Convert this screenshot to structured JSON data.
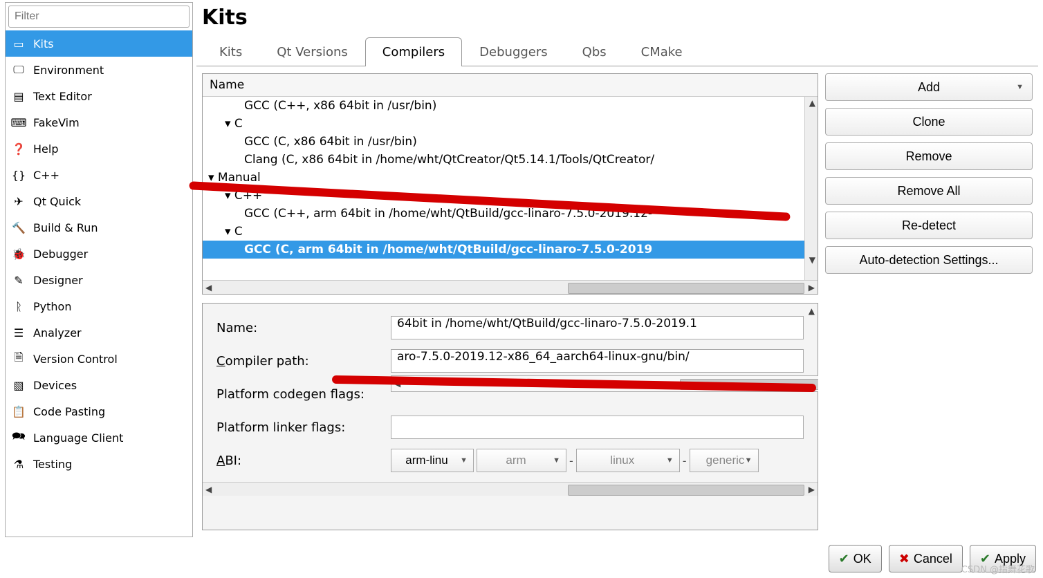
{
  "filter_placeholder": "Filter",
  "sidebar": {
    "items": [
      {
        "label": "Kits",
        "icon": "kits"
      },
      {
        "label": "Environment",
        "icon": "monitor"
      },
      {
        "label": "Text Editor",
        "icon": "document"
      },
      {
        "label": "FakeVim",
        "icon": "fakevim"
      },
      {
        "label": "Help",
        "icon": "help"
      },
      {
        "label": "C++",
        "icon": "braces"
      },
      {
        "label": "Qt Quick",
        "icon": "send"
      },
      {
        "label": "Build & Run",
        "icon": "hammer"
      },
      {
        "label": "Debugger",
        "icon": "bug"
      },
      {
        "label": "Designer",
        "icon": "pencil"
      },
      {
        "label": "Python",
        "icon": "python"
      },
      {
        "label": "Analyzer",
        "icon": "analyzer"
      },
      {
        "label": "Version Control",
        "icon": "versioncontrol"
      },
      {
        "label": "Devices",
        "icon": "devices"
      },
      {
        "label": "Code Pasting",
        "icon": "clipboard"
      },
      {
        "label": "Language Client",
        "icon": "language"
      },
      {
        "label": "Testing",
        "icon": "flask"
      }
    ],
    "selected_index": 0
  },
  "page_title": "Kits",
  "tabs": [
    "Kits",
    "Qt Versions",
    "Compilers",
    "Debuggers",
    "Qbs",
    "CMake"
  ],
  "active_tab": 2,
  "tree": {
    "header": "Name",
    "rows": [
      {
        "indent": 2,
        "text": "GCC (C++, x86 64bit in /usr/bin)"
      },
      {
        "indent": 1,
        "text": "▾  C"
      },
      {
        "indent": 2,
        "text": "GCC (C, x86 64bit in /usr/bin)"
      },
      {
        "indent": 2,
        "text": "Clang (C, x86 64bit in /home/wht/QtCreator/Qt5.14.1/Tools/QtCreator/"
      },
      {
        "indent": 0,
        "text": "▾  Manual"
      },
      {
        "indent": 1,
        "text": "▾  C++"
      },
      {
        "indent": 2,
        "text": "GCC (C++, arm 64bit in /home/wht/QtBuild/gcc-linaro-7.5.0-2019.12-"
      },
      {
        "indent": 1,
        "text": "▾  C"
      },
      {
        "indent": 2,
        "text": "GCC (C, arm 64bit in /home/wht/QtBuild/gcc-linaro-7.5.0-2019",
        "selected": true
      }
    ]
  },
  "details": {
    "name_label": "Name:",
    "name_value": "64bit in /home/wht/QtBuild/gcc-linaro-7.5.0-2019.1",
    "compiler_path_label_pre": "C",
    "compiler_path_label_post": "ompiler path:",
    "compiler_path_value": "aro-7.5.0-2019.12-x86_64_aarch64-linux-gnu/bin/",
    "platform_codegen_label": "Platform codegen flags:",
    "platform_linker_label": "Platform linker flags:",
    "abi_label_pre": "A",
    "abi_label_post": "BI:",
    "abi_primary": "arm-linu",
    "abi_parts": [
      "arm",
      "linux",
      "generic"
    ]
  },
  "side_buttons": {
    "add": "Add",
    "clone": "Clone",
    "remove": "Remove",
    "remove_all": "Remove All",
    "redetect": "Re-detect",
    "autodetect": "Auto-detection Settings..."
  },
  "footer": {
    "ok": "OK",
    "cancel": "Cancel",
    "apply": "Apply"
  },
  "watermark": "CSDN @指舞花歌"
}
